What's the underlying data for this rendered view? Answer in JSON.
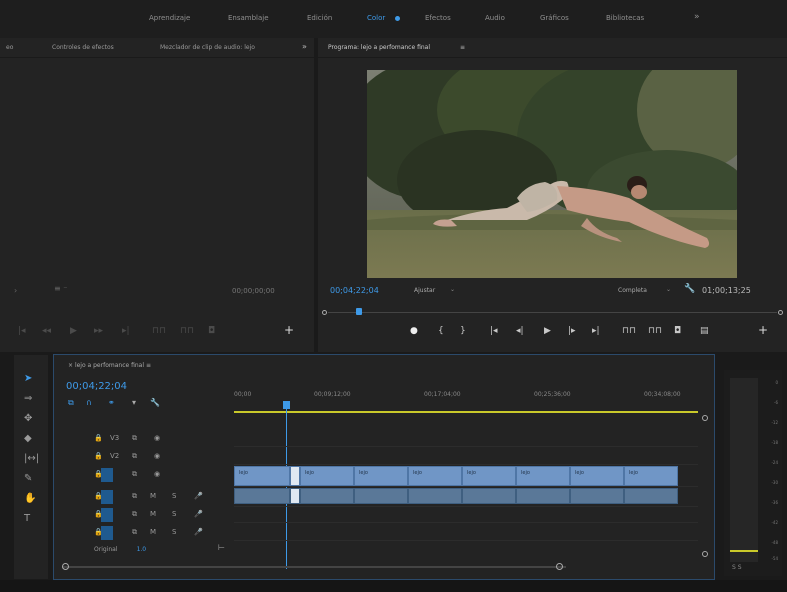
{
  "workspaces": [
    {
      "label": "Aprendizaje",
      "active": false
    },
    {
      "label": "Ensamblaje",
      "active": false
    },
    {
      "label": "Edición",
      "active": false
    },
    {
      "label": "Color",
      "active": true
    },
    {
      "label": "Efectos",
      "active": false
    },
    {
      "label": "Audio",
      "active": false
    },
    {
      "label": "Gráficos",
      "active": false
    },
    {
      "label": "Bibliotecas",
      "active": false
    }
  ],
  "source_panel": {
    "tab_effects": "Controles de efectos",
    "tab_audio": "Mezclador de clip de audio: lejo",
    "timecode": "00;00;00;00"
  },
  "program_panel": {
    "title": "Programa: lejo a perfomance final",
    "timecode": "00;04;22;04",
    "fit": "Ajustar",
    "quality": "Completa",
    "duration": "01;00;13;25"
  },
  "timeline": {
    "title": "lejo a perfomance final",
    "timecode": "00;04;22;04",
    "ruler": [
      "00;00",
      "00;09;12;00",
      "00;17;04;00",
      "00;25;36;00",
      "00;34;08;00"
    ],
    "original_label": "Original",
    "original_value": "1.0",
    "clip_label": "lejo"
  },
  "colors": {
    "accent": "#3e9ae8",
    "workarea": "#c9c92a",
    "clip_video": "#7096c6",
    "clip_audio": "#5a7898"
  }
}
